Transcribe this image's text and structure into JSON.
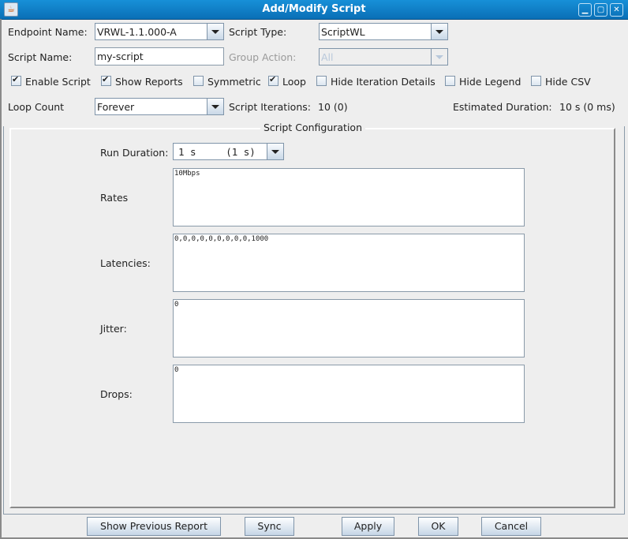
{
  "window": {
    "title": "Add/Modify Script",
    "controls": [
      "minimize-icon",
      "maximize-icon",
      "close-icon"
    ]
  },
  "form": {
    "endpoint_name_label": "Endpoint Name:",
    "endpoint_name_value": "VRWL-1.1.000-A",
    "script_type_label": "Script Type:",
    "script_type_value": "ScriptWL",
    "script_name_label": "Script Name:",
    "script_name_value": "my-script",
    "group_action_label": "Group Action:",
    "group_action_value": "All",
    "checkboxes": [
      {
        "label": "Enable Script",
        "checked": true
      },
      {
        "label": "Show Reports",
        "checked": true
      },
      {
        "label": "Symmetric",
        "checked": false
      },
      {
        "label": "Loop",
        "checked": true
      },
      {
        "label": "Hide Iteration Details",
        "checked": false
      },
      {
        "label": "Hide Legend",
        "checked": false
      },
      {
        "label": "Hide CSV",
        "checked": false
      }
    ],
    "loop_count_label": "Loop Count",
    "loop_count_value": "Forever",
    "script_iterations_label": "Script Iterations:",
    "script_iterations_value": "10 (0)",
    "estimated_duration_label": "Estimated Duration:",
    "estimated_duration_value": "10 s (0 ms)"
  },
  "config": {
    "title": "Script Configuration",
    "run_duration_label": "Run Duration:",
    "run_duration_value": "1 s     (1 s)",
    "rates_label": "Rates",
    "rates_value": "10Mbps",
    "latencies_label": "Latencies:",
    "latencies_value": "0,0,0,0,0,0,0,0,0,1000",
    "jitter_label": "Jitter:",
    "jitter_value": "0",
    "drops_label": "Drops:",
    "drops_value": "0"
  },
  "buttons": {
    "show_previous_report": "Show Previous Report",
    "sync": "Sync",
    "apply": "Apply",
    "ok": "OK",
    "cancel": "Cancel"
  }
}
